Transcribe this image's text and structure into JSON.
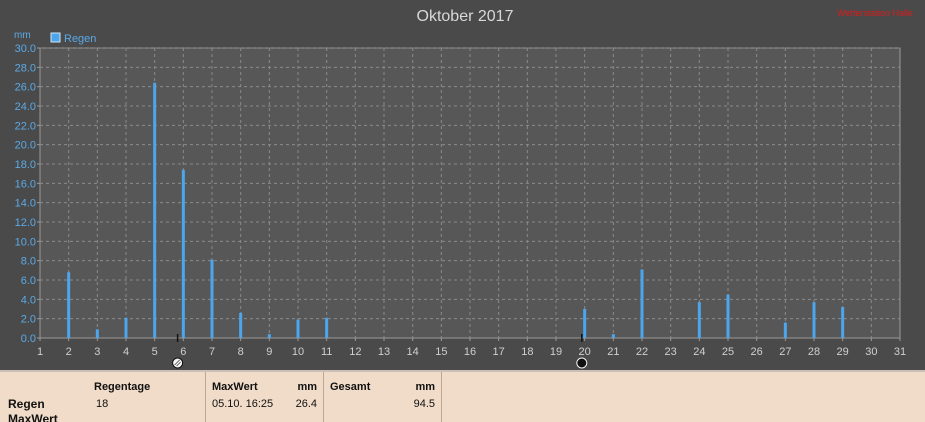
{
  "chart_data": {
    "type": "bar",
    "title": "Oktober 2017",
    "watermark": "Wetterstation Halle",
    "ylabel": "mm",
    "ylim": [
      0,
      30
    ],
    "yticks": [
      "0.0",
      "2.0",
      "4.0",
      "6.0",
      "8.0",
      "10.0",
      "12.0",
      "14.0",
      "16.0",
      "18.0",
      "20.0",
      "22.0",
      "24.0",
      "26.0",
      "28.0",
      "30.0"
    ],
    "xlim": [
      1,
      31
    ],
    "categories": [
      "1",
      "2",
      "3",
      "4",
      "5",
      "6",
      "7",
      "8",
      "9",
      "10",
      "11",
      "12",
      "13",
      "14",
      "15",
      "16",
      "17",
      "18",
      "19",
      "20",
      "21",
      "22",
      "23",
      "24",
      "25",
      "26",
      "27",
      "28",
      "29",
      "30",
      "31"
    ],
    "series": [
      {
        "name": "Regen",
        "color": "#4da6ec",
        "points": [
          {
            "x": 2,
            "y": 6.8
          },
          {
            "x": 3,
            "y": 0.9
          },
          {
            "x": 4,
            "y": 2.1
          },
          {
            "x": 5,
            "y": 26.4
          },
          {
            "x": 6,
            "y": 17.4
          },
          {
            "x": 7,
            "y": 8.1
          },
          {
            "x": 8,
            "y": 2.6
          },
          {
            "x": 9,
            "y": 0.4
          },
          {
            "x": 10,
            "y": 1.9
          },
          {
            "x": 11,
            "y": 2.1
          },
          {
            "x": 20,
            "y": 3.0
          },
          {
            "x": 21,
            "y": 0.4
          },
          {
            "x": 22,
            "y": 7.1
          },
          {
            "x": 24,
            "y": 3.7
          },
          {
            "x": 25,
            "y": 4.5
          },
          {
            "x": 27,
            "y": 1.6
          },
          {
            "x": 28,
            "y": 3.7
          },
          {
            "x": 29,
            "y": 3.2
          }
        ]
      }
    ],
    "moon_markers": [
      {
        "x": 5.8,
        "icon": "full-moon-icon"
      },
      {
        "x": 19.9,
        "icon": "new-moon-icon"
      }
    ],
    "grid": true,
    "legend_position": "top-left"
  },
  "colors": {
    "background": "#4a4a4a",
    "plot_area": "#575757",
    "grid": "#8a8a8a",
    "bar": "#4da6ec",
    "summary_bg": "#f0dcc8"
  },
  "summary": {
    "row_label": "Regen",
    "row_label_2": "MaxWert",
    "regentage_header": "Regentage",
    "regentage_value": "18",
    "maxwert_header": "MaxWert",
    "maxwert_unit": "mm",
    "maxwert_date": "05.10.  16:25",
    "maxwert_value": "26.4",
    "gesamt_header": "Gesamt",
    "gesamt_unit": "mm",
    "gesamt_value": "94.5"
  }
}
